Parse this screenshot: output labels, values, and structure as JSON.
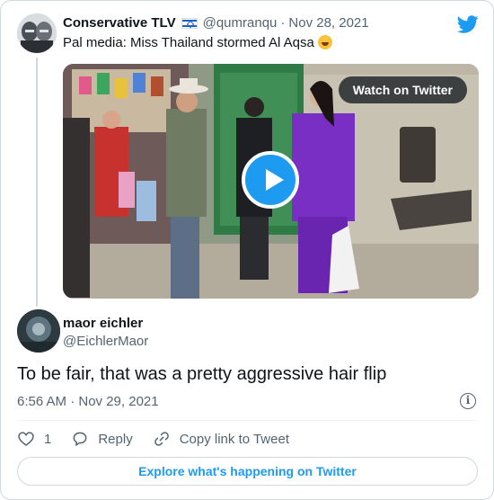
{
  "parent_tweet": {
    "author_name": "Conservative TLV",
    "flag_icon": "israel-flag-icon",
    "handle": "@qumranqu",
    "separator": "·",
    "date": "Nov 28, 2021",
    "text": "Pal media: Miss Thailand stormed Al Aqsa",
    "emoji_icon": "laughing-tears-emoji-icon",
    "media": {
      "watch_label": "Watch on Twitter",
      "play_icon": "play-icon"
    }
  },
  "reply_tweet": {
    "author_name": "maor eichler",
    "handle": "@EichlerMaor",
    "text": "To be fair, that was a pretty aggressive hair flip",
    "timestamp": "6:56 AM · Nov 29, 2021"
  },
  "actions": {
    "like_count": "1",
    "reply_label": "Reply",
    "copy_label": "Copy link to Tweet"
  },
  "footer": {
    "explore_label": "Explore what's happening on Twitter"
  },
  "colors": {
    "twitter_blue": "#1d9bf0",
    "text_primary": "#0f1419",
    "text_secondary": "#536471",
    "border": "#cfd9de",
    "dress_purple": "#7a2fc4"
  }
}
